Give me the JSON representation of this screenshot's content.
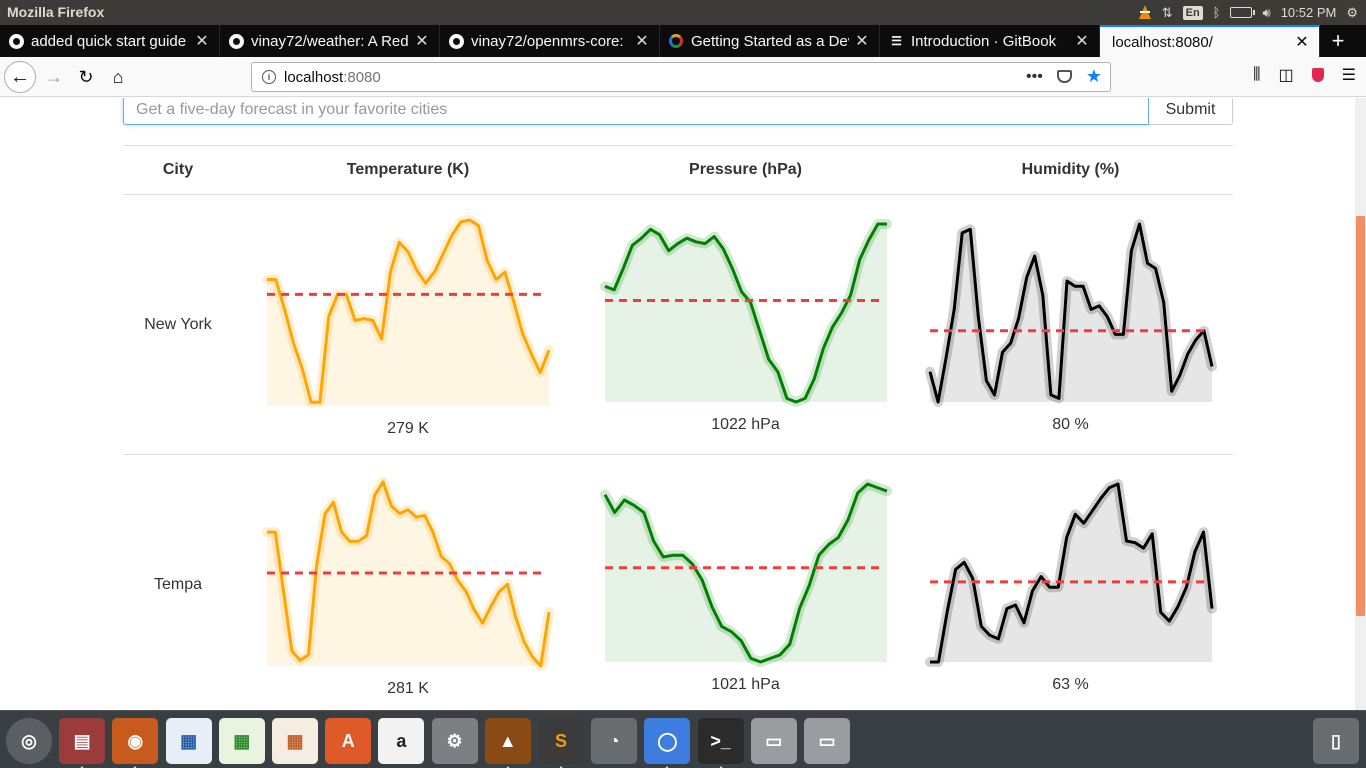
{
  "os_bar": {
    "app_title": "Mozilla Firefox",
    "keyboard_layout": "En",
    "clock": "10:52 PM"
  },
  "tabs": [
    {
      "label": "added quick start guide",
      "icon": "github-icon",
      "active": false
    },
    {
      "label": "vinay72/weather: A Red",
      "icon": "github-icon",
      "active": false
    },
    {
      "label": "vinay72/openmrs-core:",
      "icon": "github-icon",
      "active": false
    },
    {
      "label": "Getting Started as a Dev",
      "icon": "ring-icon",
      "active": false
    },
    {
      "label": "Introduction · GitBook",
      "icon": "book-icon",
      "active": false
    },
    {
      "label": "localhost:8080/",
      "icon": "",
      "active": true
    }
  ],
  "urlbar": {
    "host": "localhost",
    "port": ":8080"
  },
  "search": {
    "placeholder": "Get a five-day forecast in your favorite cities",
    "submit_label": "Submit"
  },
  "table": {
    "headers": {
      "city": "City",
      "temperature": "Temperature (K)",
      "pressure": "Pressure (hPa)",
      "humidity": "Humidity (%)"
    },
    "rows": [
      {
        "city": "New York",
        "temp_avg": "279 K",
        "pressure_avg": "1022 hPa",
        "humidity_avg": "80 %"
      },
      {
        "city": "Tempa",
        "temp_avg": "281 K",
        "pressure_avg": "1021 hPa",
        "humidity_avg": "63 %"
      }
    ]
  },
  "colors": {
    "temperature_line": "#ffa500",
    "temperature_fill": "#fff5e3",
    "pressure_line": "#008000",
    "pressure_fill": "#e5f2e5",
    "humidity_line": "#000000",
    "humidity_fill": "#e6e6e6",
    "reference_line": "#f23c3c",
    "tab_accent": "#0a84ff",
    "scroll_thumb": "#ef8f63"
  },
  "chart_data": [
    {
      "type": "line",
      "city": "New York",
      "metric": "temperature",
      "values": [
        0.68,
        0.68,
        0.52,
        0.34,
        0.2,
        0.02,
        0.02,
        0.48,
        0.6,
        0.6,
        0.46,
        0.47,
        0.46,
        0.36,
        0.72,
        0.88,
        0.83,
        0.73,
        0.66,
        0.72,
        0.82,
        0.92,
        0.99,
        1.0,
        0.97,
        0.78,
        0.68,
        0.72,
        0.56,
        0.39,
        0.28,
        0.18,
        0.3
      ],
      "reference": 0.6
    },
    {
      "type": "line",
      "city": "New York",
      "metric": "pressure",
      "values": [
        0.65,
        0.63,
        0.75,
        0.88,
        0.92,
        0.97,
        0.94,
        0.85,
        0.89,
        0.92,
        0.9,
        0.89,
        0.93,
        0.86,
        0.75,
        0.62,
        0.56,
        0.4,
        0.24,
        0.17,
        0.02,
        0.0,
        0.02,
        0.13,
        0.3,
        0.42,
        0.5,
        0.6,
        0.8,
        0.91,
        1.0,
        1.0
      ],
      "reference": 0.57
    },
    {
      "type": "line",
      "city": "New York",
      "metric": "humidity",
      "values": [
        0.17,
        0.0,
        0.25,
        0.52,
        0.95,
        0.97,
        0.48,
        0.12,
        0.04,
        0.28,
        0.33,
        0.47,
        0.7,
        0.82,
        0.6,
        0.04,
        0.02,
        0.68,
        0.65,
        0.65,
        0.52,
        0.54,
        0.48,
        0.38,
        0.38,
        0.85,
        1.0,
        0.78,
        0.75,
        0.56,
        0.06,
        0.15,
        0.27,
        0.35,
        0.4,
        0.2
      ],
      "reference": 0.4
    },
    {
      "type": "line",
      "city": "Tempa",
      "metric": "temperature",
      "values": [
        0.72,
        0.72,
        0.4,
        0.08,
        0.03,
        0.06,
        0.55,
        0.82,
        0.88,
        0.72,
        0.67,
        0.67,
        0.7,
        0.92,
        0.99,
        0.86,
        0.82,
        0.84,
        0.8,
        0.81,
        0.72,
        0.59,
        0.55,
        0.46,
        0.4,
        0.3,
        0.23,
        0.32,
        0.4,
        0.44,
        0.26,
        0.13,
        0.05,
        0.0,
        0.29
      ],
      "reference": 0.5
    },
    {
      "type": "line",
      "city": "Tempa",
      "metric": "pressure",
      "values": [
        0.94,
        0.84,
        0.91,
        0.88,
        0.84,
        0.68,
        0.59,
        0.6,
        0.6,
        0.55,
        0.46,
        0.31,
        0.2,
        0.17,
        0.12,
        0.02,
        0.0,
        0.02,
        0.04,
        0.1,
        0.3,
        0.43,
        0.6,
        0.66,
        0.7,
        0.8,
        0.95,
        1.0,
        0.98,
        0.96
      ],
      "reference": 0.53
    },
    {
      "type": "line",
      "city": "Tempa",
      "metric": "humidity",
      "values": [
        0.0,
        0.0,
        0.28,
        0.52,
        0.56,
        0.47,
        0.2,
        0.15,
        0.13,
        0.3,
        0.32,
        0.22,
        0.4,
        0.48,
        0.42,
        0.42,
        0.7,
        0.83,
        0.78,
        0.85,
        0.92,
        0.98,
        1.0,
        0.68,
        0.67,
        0.64,
        0.72,
        0.28,
        0.23,
        0.31,
        0.42,
        0.62,
        0.73,
        0.3
      ],
      "reference": 0.45
    }
  ],
  "dock": {
    "items": [
      {
        "icon": "ubuntu-logo-icon",
        "running": false
      },
      {
        "icon": "files-icon",
        "running": true
      },
      {
        "icon": "firefox-icon",
        "running": true
      },
      {
        "icon": "writer-icon",
        "running": false
      },
      {
        "icon": "calc-icon",
        "running": false
      },
      {
        "icon": "impress-icon",
        "running": false
      },
      {
        "icon": "software-center-icon",
        "running": false
      },
      {
        "icon": "amazon-icon",
        "running": false
      },
      {
        "icon": "settings-icon",
        "running": false
      },
      {
        "icon": "vlc-icon",
        "running": true
      },
      {
        "icon": "sublime-text-icon",
        "running": true
      },
      {
        "icon": "disk-usage-icon",
        "running": false
      },
      {
        "icon": "chromium-icon",
        "running": true
      },
      {
        "icon": "terminal-icon",
        "running": true
      },
      {
        "icon": "drive-icon",
        "running": false
      },
      {
        "icon": "drive-icon",
        "running": false
      },
      {
        "icon": "trash-icon",
        "running": false
      }
    ]
  }
}
